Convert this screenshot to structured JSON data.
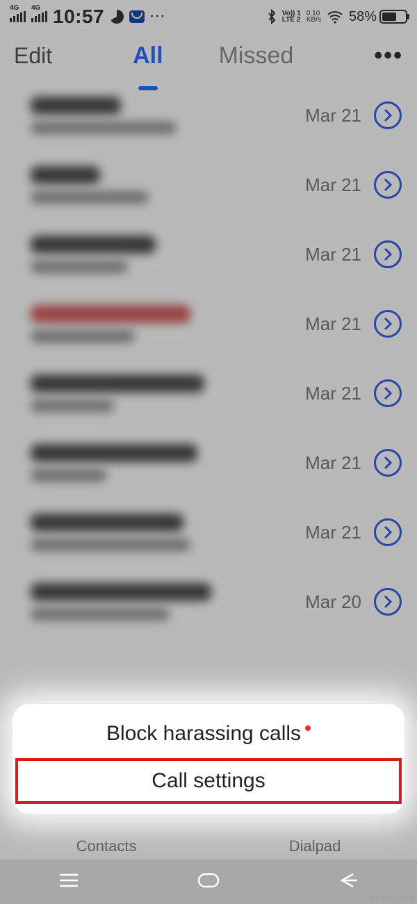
{
  "status": {
    "sim1_net": "4G",
    "sim2_net": "4G",
    "time": "10:57",
    "volte_l1": "Vo)) 1",
    "volte_l2": "LTE 2",
    "speed_l1": "0.10",
    "speed_l2": "KB/s",
    "battery": "58%"
  },
  "header": {
    "edit": "Edit",
    "all": "All",
    "missed": "Missed"
  },
  "calls": [
    {
      "date": "Mar 21"
    },
    {
      "date": "Mar 21"
    },
    {
      "date": "Mar 21"
    },
    {
      "date": "Mar 21"
    },
    {
      "date": "Mar 21"
    },
    {
      "date": "Mar 21"
    },
    {
      "date": "Mar 21"
    },
    {
      "date": "Mar 20"
    }
  ],
  "menu": {
    "block": "Block harassing calls",
    "settings": "Call settings"
  },
  "bottom": {
    "contacts": "Contacts",
    "dialpad": "Dialpad"
  },
  "watermark": "wsxdn.com"
}
